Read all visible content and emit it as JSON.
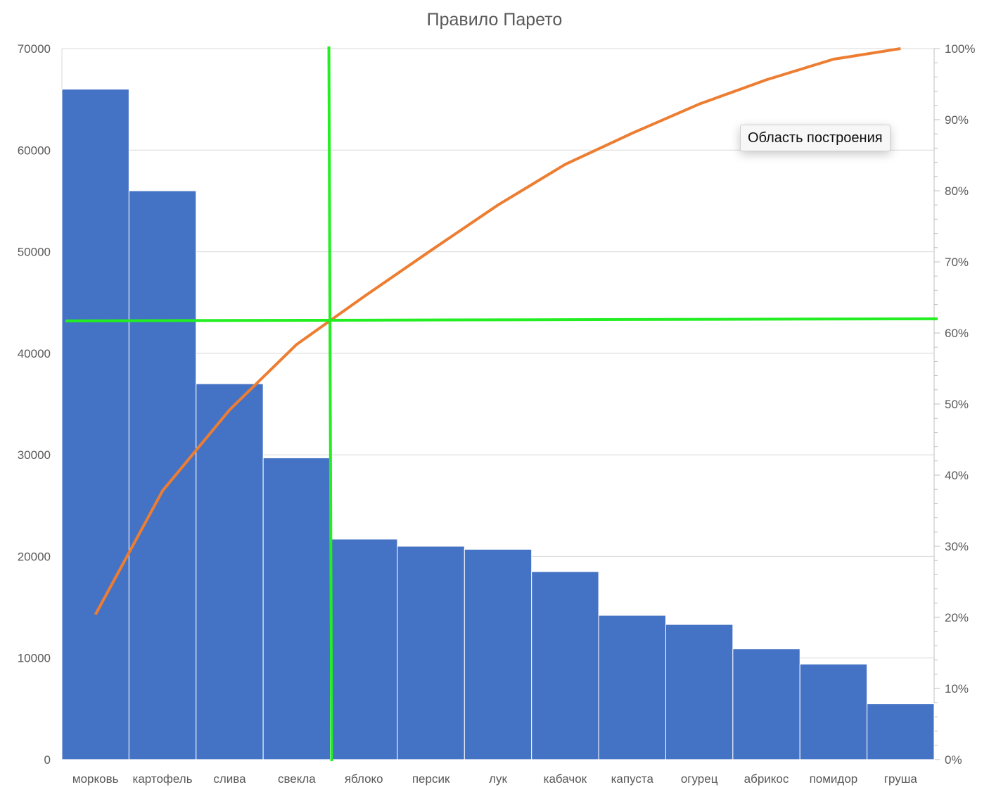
{
  "chart_data": {
    "type": "bar",
    "title": "Правило Парето",
    "categories": [
      "морковь",
      "картофель",
      "слива",
      "свекла",
      "яблоко",
      "персик",
      "лук",
      "кабачок",
      "капуста",
      "огурец",
      "абрикос",
      "помидор",
      "груша"
    ],
    "series": [
      {
        "kind": "bar",
        "values": [
          66000,
          56000,
          37000,
          29700,
          21700,
          21000,
          20700,
          18500,
          14200,
          13300,
          10900,
          9400,
          5500
        ],
        "color": "#4472c4"
      },
      {
        "kind": "line",
        "axis": "secondary",
        "values": [
          20.4,
          37.8,
          49.2,
          58.4,
          65.1,
          71.6,
          78.0,
          83.7,
          88.1,
          92.2,
          95.6,
          98.5,
          100.0
        ],
        "color": "#ed7d31"
      }
    ],
    "y_axis": {
      "ylim": [
        0,
        70000
      ],
      "ticks": [
        "0",
        "10000",
        "20000",
        "30000",
        "40000",
        "50000",
        "60000",
        "70000"
      ]
    },
    "y2_axis": {
      "ylim": [
        0,
        100
      ],
      "ticks": [
        "0%",
        "10%",
        "20%",
        "30%",
        "40%",
        "50%",
        "60%",
        "70%",
        "80%",
        "90%",
        "100%"
      ]
    },
    "grid": true,
    "overlay_lines": {
      "color": "#22ee22",
      "cutoff_category_boundary": 4,
      "cutoff_percent": 61.8
    },
    "tooltip": "Область построения"
  }
}
